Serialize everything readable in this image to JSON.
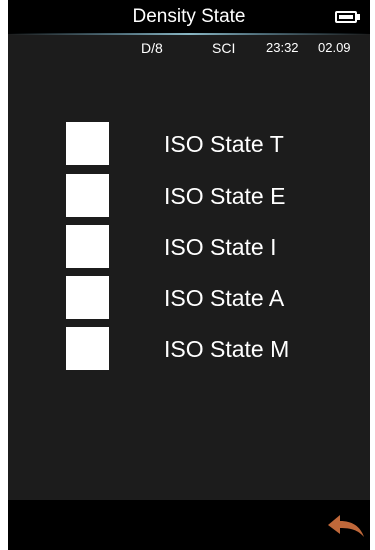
{
  "header": {
    "title": "Density State",
    "battery_icon": "battery-full-icon"
  },
  "status": {
    "geometry": "D/8",
    "mode": "SCI",
    "time": "23:32",
    "date": "02.09"
  },
  "options": [
    {
      "label": "ISO State T",
      "checked": true
    },
    {
      "label": "ISO State E",
      "checked": false
    },
    {
      "label": "ISO State I",
      "checked": false
    },
    {
      "label": "ISO State A",
      "checked": false
    },
    {
      "label": "ISO State M",
      "checked": false
    }
  ],
  "footer": {
    "back_icon": "back-arrow-icon"
  },
  "colors": {
    "accent": "#1e8fd8",
    "background": "#1c1c1c",
    "bars": "#000000",
    "back_arrow": "#c0683a"
  }
}
